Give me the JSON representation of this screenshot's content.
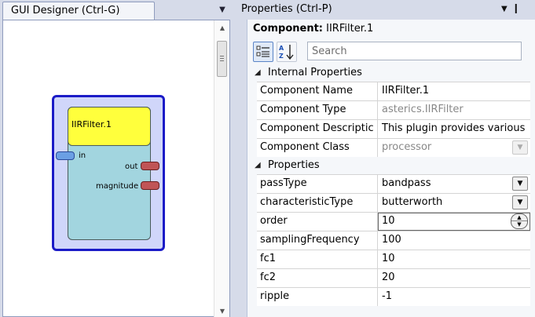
{
  "gui_designer": {
    "tab_label": "GUI Designer (Ctrl-G)",
    "component": {
      "title": "IIRFilter.1",
      "input_port": "in",
      "output_ports": [
        "out",
        "magnitude"
      ]
    }
  },
  "properties": {
    "title": "Properties (Ctrl-P)",
    "component_label": "Component:",
    "component_value": "IIRFilter.1",
    "search_placeholder": "Search",
    "internal_header": "Internal Properties",
    "internal_rows": [
      {
        "name": "Component Name",
        "value": "IIRFilter.1"
      },
      {
        "name": "Component Type",
        "value": "asterics.IIRFilter"
      },
      {
        "name": "Component Descriptic",
        "value": "This plugin provides various"
      },
      {
        "name": "Component Class",
        "value": "processor"
      }
    ],
    "props_header": "Properties",
    "property_rows": [
      {
        "name": "passType",
        "value": "bandpass"
      },
      {
        "name": "characteristicType",
        "value": "butterworth"
      },
      {
        "name": "order",
        "value": "10"
      },
      {
        "name": "samplingFrequency",
        "value": "100"
      },
      {
        "name": "fc1",
        "value": "10"
      },
      {
        "name": "fc2",
        "value": "20"
      },
      {
        "name": "ripple",
        "value": "-1"
      }
    ]
  }
}
